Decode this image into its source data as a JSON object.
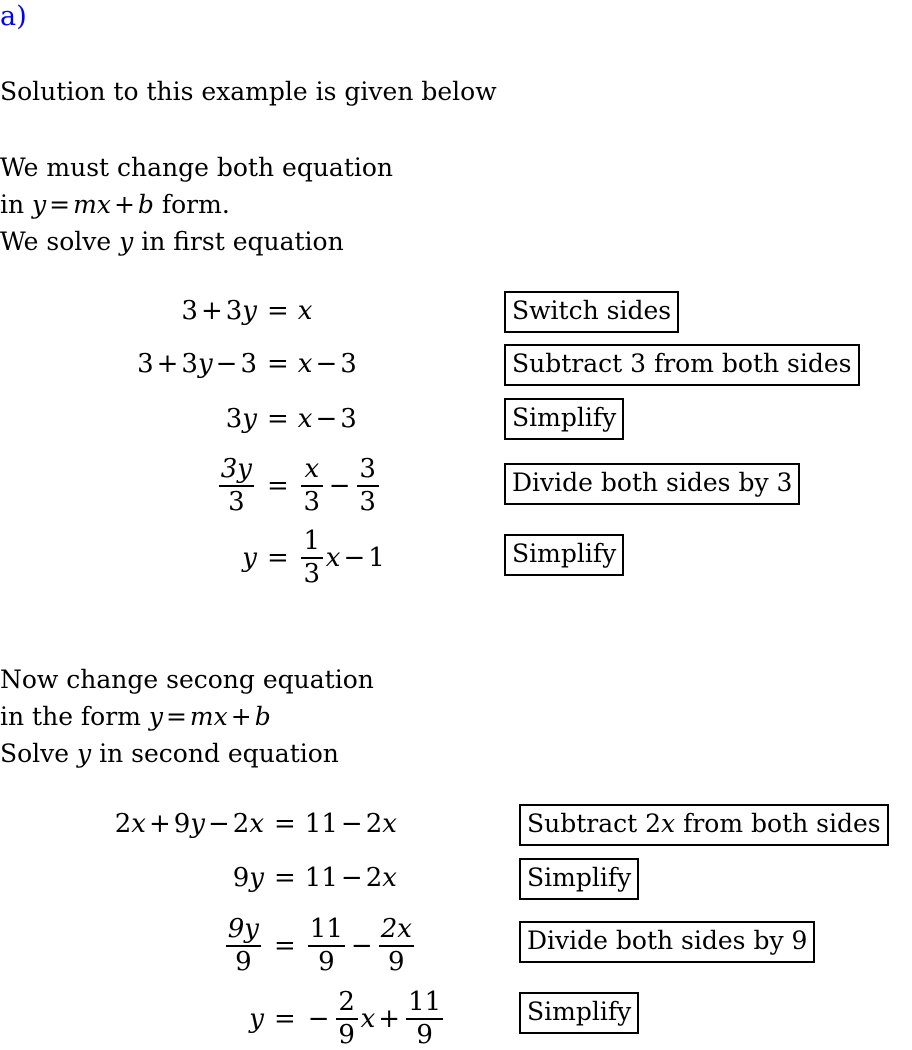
{
  "document": {
    "section_label": "a)",
    "section_label_color": "#0000FF",
    "text_color": "#000000",
    "background_color": "#FFFFFF"
  },
  "prose": {
    "solution": {
      "line1": "Solution to this example is given below"
    },
    "change_first": {
      "line1": "We must change both equation",
      "line2_prefix": "in ",
      "line2_var_y": "y",
      "line2_eq": "=",
      "line2_var_m": "m",
      "line2_var_x": "x",
      "line2_plus": "+",
      "line2_var_b": "b",
      "line2_suffix": " form.",
      "line3_prefix": "We solve ",
      "line3_var_y": "y",
      "line3_suffix": " in first equation"
    },
    "change_second": {
      "line1": "Now change secong equation",
      "line2_prefix": "in the form ",
      "line2_var_y": "y",
      "line2_eq": "=",
      "line2_var_m": "m",
      "line2_var_x": "x",
      "line2_plus": "+",
      "line2_var_b": "b",
      "line3_prefix": "Solve ",
      "line3_var_y": "y",
      "line3_suffix": " in second equation"
    }
  },
  "equation_block_1": {
    "rows": [
      {
        "lhs": "3 + 3y = x",
        "rel": "=",
        "lhs_parts": [
          "3",
          "+",
          "3",
          "y"
        ],
        "rhs_parts": [
          "x"
        ],
        "note": "Switch sides"
      },
      {
        "lhs": "3 + 3y - 3 = x - 3",
        "rel": "=",
        "lhs_parts": [
          "3",
          "+",
          "3",
          "y",
          "−",
          "3"
        ],
        "rhs_parts": [
          "x",
          "−",
          "3"
        ],
        "note": "Subtract 3 from both sides"
      },
      {
        "lhs": "3y = x - 3",
        "rel": "=",
        "lhs_parts": [
          "3",
          "y"
        ],
        "rhs_parts": [
          "x",
          "−",
          "3"
        ],
        "note": "Simplify"
      },
      {
        "lhs": "3y/3 = x/3 - 3/3",
        "rel": "=",
        "lhs_frac": {
          "num": "3y",
          "den": "3"
        },
        "rhs_frac_1": {
          "num": "x",
          "den": "3"
        },
        "rhs_minus": "−",
        "rhs_frac_2": {
          "num": "3",
          "den": "3"
        },
        "note": "Divide both sides by 3"
      },
      {
        "lhs": "y = (1/3)x - 1",
        "rel": "=",
        "lhs_var": "y",
        "rhs_frac": {
          "num": "1",
          "den": "3"
        },
        "rhs_var": "x",
        "rhs_minus": "−",
        "rhs_const": "1",
        "note": "Simplify"
      }
    ],
    "notes": [
      "Switch sides",
      "Subtract 3 from both sides",
      "Simplify",
      "Divide both sides by 3",
      "Simplify"
    ],
    "eq1_lhs_3": "3",
    "eq1_plus": "+",
    "eq1_3": "3",
    "eq1_y": "y",
    "eq1_rel": "=",
    "eq1_x": "x",
    "eq2_3": "3",
    "eq2_plus": "+",
    "eq2_3b": "3",
    "eq2_y": "y",
    "eq2_minus": "−",
    "eq2_3c": "3",
    "eq2_rel": "=",
    "eq2_x": "x",
    "eq2_minus2": "−",
    "eq2_3d": "3",
    "eq3_3": "3",
    "eq3_y": "y",
    "eq3_rel": "=",
    "eq3_x": "x",
    "eq3_minus": "−",
    "eq3_3b": "3",
    "eq4_num": "3y",
    "eq4_den": "3",
    "eq4_rel": "=",
    "eq4_rnum1": "x",
    "eq4_rden1": "3",
    "eq4_minus": "−",
    "eq4_rnum2": "3",
    "eq4_rden2": "3",
    "eq5_y": "y",
    "eq5_rel": "=",
    "eq5_num": "1",
    "eq5_den": "3",
    "eq5_x": "x",
    "eq5_minus": "−",
    "eq5_one": "1"
  },
  "equation_block_2": {
    "rows": [
      {
        "lhs": "2x + 9y - 2x = 11 - 2x",
        "note": "Subtract 2x from both sides"
      },
      {
        "lhs": "9y = 11 - 2x",
        "note": "Simplify"
      },
      {
        "lhs": "9y/9 = 11/9 - 2x/9",
        "note": "Divide both sides by 9"
      },
      {
        "lhs": "y = -(2/9)x + 11/9",
        "note": "Simplify"
      }
    ],
    "notes": [
      "Subtract 2x from both sides",
      "Simplify",
      "Divide both sides by 9",
      "Simplify"
    ],
    "note1_prefix": "Subtract ",
    "note1_num": "2",
    "note1_var": "x",
    "note1_suffix": " from both sides",
    "eq1_2": "2",
    "eq1_x": "x",
    "eq1_plus": "+",
    "eq1_9": "9",
    "eq1_y": "y",
    "eq1_minus": "−",
    "eq1_2b": "2",
    "eq1_xb": "x",
    "eq1_rel": "=",
    "eq1_11": "11",
    "eq1_minus2": "−",
    "eq1_2c": "2",
    "eq1_xc": "x",
    "eq2_9": "9",
    "eq2_y": "y",
    "eq2_rel": "=",
    "eq2_11": "11",
    "eq2_minus": "−",
    "eq2_2": "2",
    "eq2_x": "x",
    "eq3_num": "9y",
    "eq3_den": "9",
    "eq3_rel": "=",
    "eq3_rnum1": "11",
    "eq3_rden1": "9",
    "eq3_minus": "−",
    "eq3_rnum2": "2x",
    "eq3_rden2": "9",
    "eq4_y": "y",
    "eq4_rel": "=",
    "eq4_neg": "−",
    "eq4_num": "2",
    "eq4_den": "9",
    "eq4_x": "x",
    "eq4_plus": "+",
    "eq4_num2": "11",
    "eq4_den2": "9"
  }
}
